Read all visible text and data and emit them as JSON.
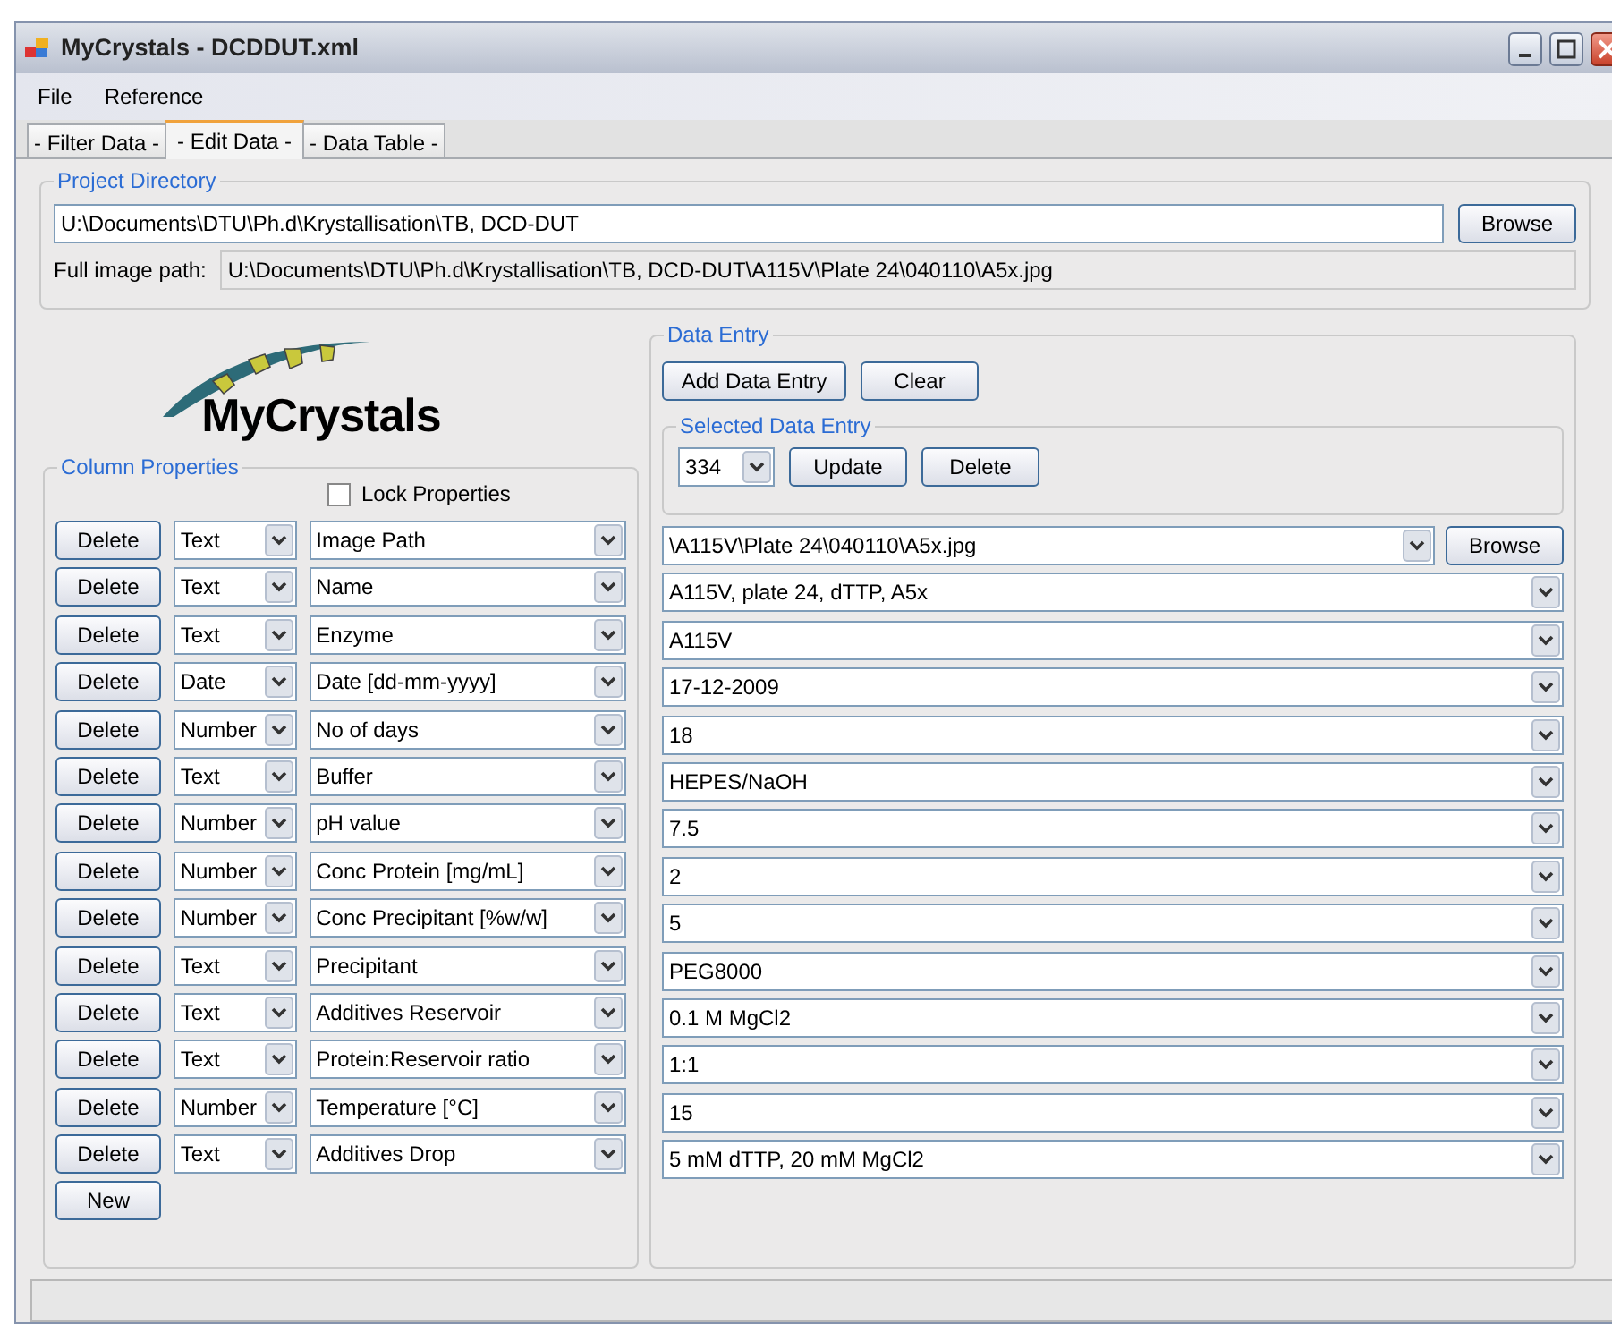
{
  "window": {
    "title": "MyCrystals - DCDDUT.xml"
  },
  "menu": [
    "File",
    "Reference"
  ],
  "tabs": [
    {
      "label": "- Filter Data -",
      "selected": false
    },
    {
      "label": "- Edit Data -",
      "selected": true
    },
    {
      "label": "- Data Table -",
      "selected": false
    }
  ],
  "project_directory": {
    "title": "Project Directory",
    "path": "U:\\Documents\\DTU\\Ph.d\\Krystallisation\\TB, DCD-DUT",
    "browse": "Browse",
    "full_image_path_label": "Full image path:",
    "full_image_path": "U:\\Documents\\DTU\\Ph.d\\Krystallisation\\TB, DCD-DUT\\A115V\\Plate 24\\040110\\A5x.jpg"
  },
  "logo": {
    "text": "MyCrystals"
  },
  "column_properties": {
    "title": "Column Properties",
    "lock_label": "Lock Properties",
    "lock_checked": false,
    "new_button": "New",
    "rows": [
      {
        "delete": "Delete",
        "type": "Text",
        "name": "Image Path"
      },
      {
        "delete": "Delete",
        "type": "Text",
        "name": "Name"
      },
      {
        "delete": "Delete",
        "type": "Text",
        "name": "Enzyme"
      },
      {
        "delete": "Delete",
        "type": "Date",
        "name": "Date [dd-mm-yyyy]"
      },
      {
        "delete": "Delete",
        "type": "Number",
        "name": "No of days"
      },
      {
        "delete": "Delete",
        "type": "Text",
        "name": "Buffer"
      },
      {
        "delete": "Delete",
        "type": "Number",
        "name": "pH value"
      },
      {
        "delete": "Delete",
        "type": "Number",
        "name": "Conc Protein [mg/mL]"
      },
      {
        "delete": "Delete",
        "type": "Number",
        "name": "Conc Precipitant [%w/w]"
      },
      {
        "delete": "Delete",
        "type": "Text",
        "name": "Precipitant"
      },
      {
        "delete": "Delete",
        "type": "Text",
        "name": "Additives Reservoir"
      },
      {
        "delete": "Delete",
        "type": "Text",
        "name": "Protein:Reservoir ratio"
      },
      {
        "delete": "Delete",
        "type": "Number",
        "name": "Temperature [°C]"
      },
      {
        "delete": "Delete",
        "type": "Text",
        "name": "Additives Drop"
      }
    ]
  },
  "data_entry": {
    "title": "Data Entry",
    "add_button": "Add Data Entry",
    "clear_button": "Clear",
    "selected_entry": {
      "title": "Selected Data Entry",
      "value": "334",
      "update_button": "Update",
      "delete_button": "Delete"
    },
    "browse_button": "Browse",
    "values": [
      "\\A115V\\Plate 24\\040110\\A5x.jpg",
      "A115V, plate 24, dTTP, A5x",
      "A115V",
      "17-12-2009",
      "18",
      "HEPES/NaOH",
      "7.5",
      "2",
      "5",
      "PEG8000",
      "0.1 M MgCl2",
      "1:1",
      "15",
      "5 mM dTTP, 20 mM MgCl2"
    ]
  }
}
